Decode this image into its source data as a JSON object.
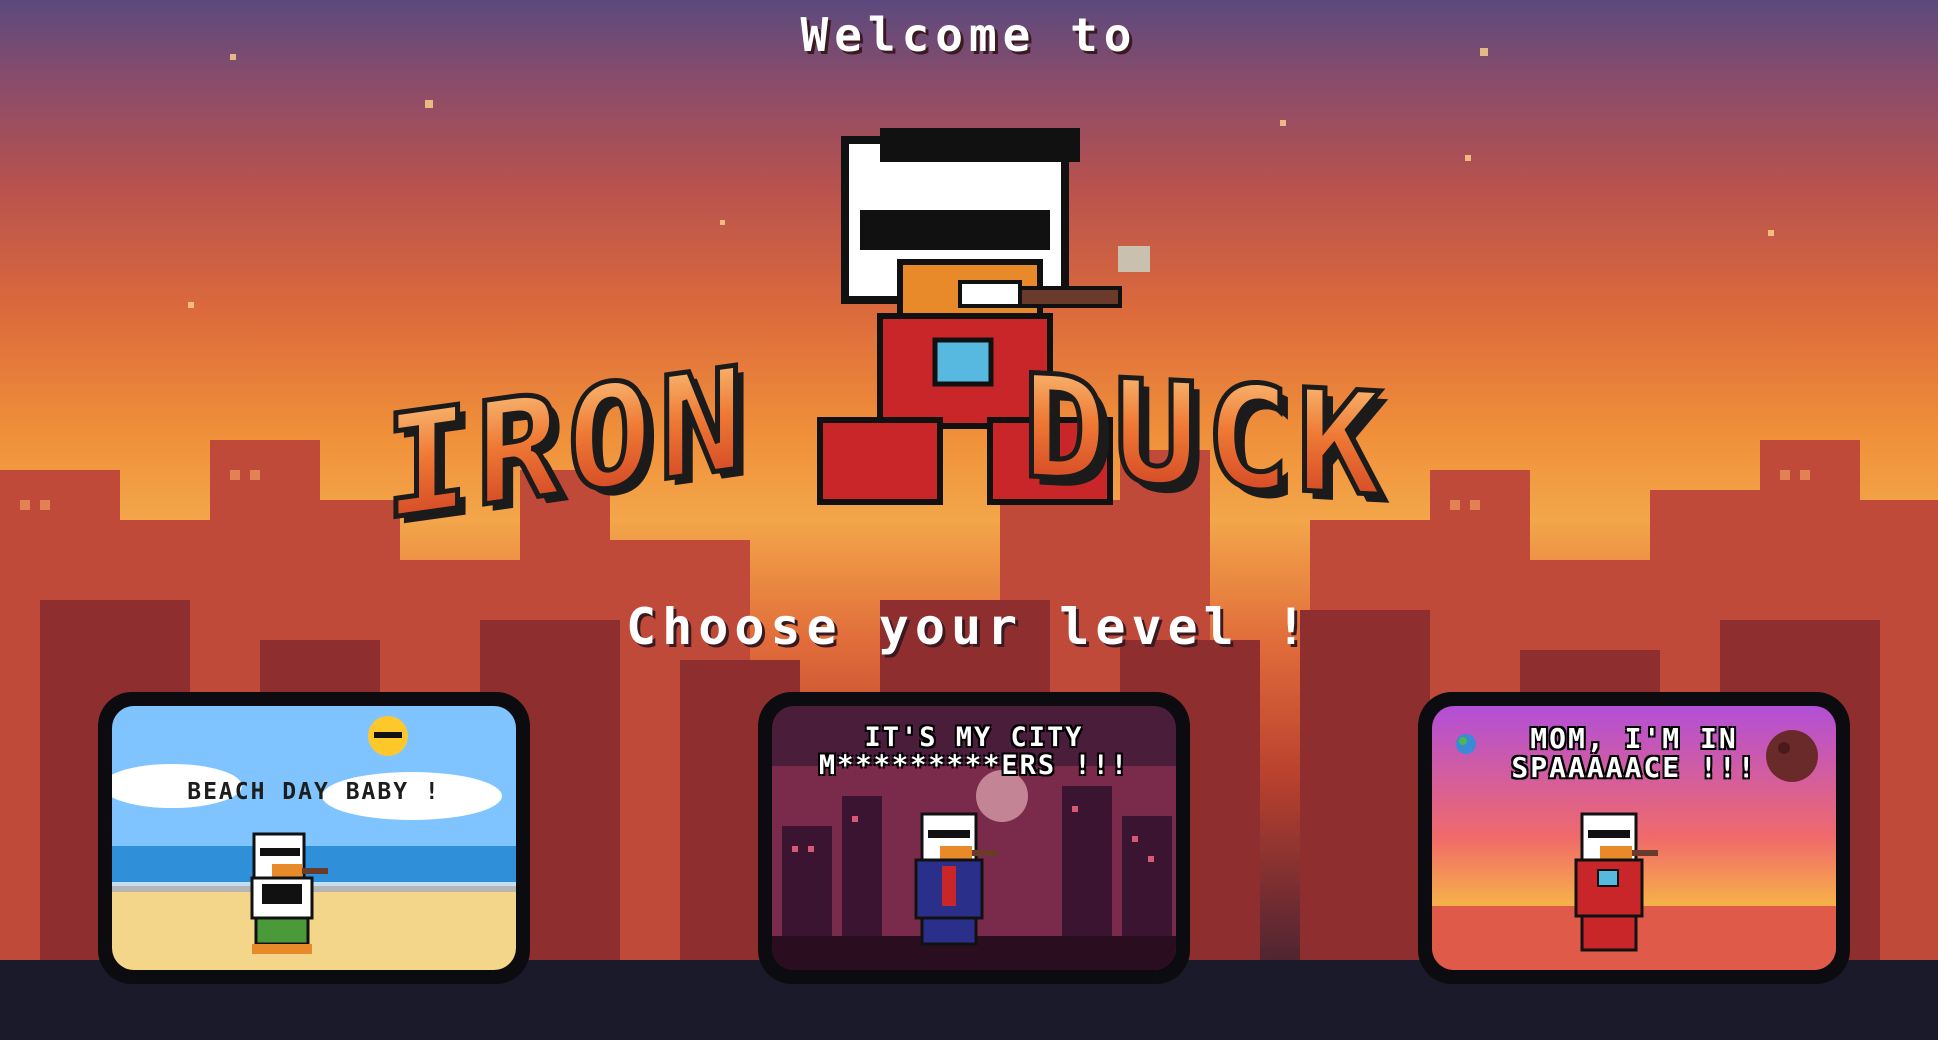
{
  "title": {
    "welcome": "Welcome to",
    "logo_left": "IRON",
    "logo_right": "DUCK"
  },
  "prompt": "Choose your level !",
  "levels": [
    {
      "id": "beach",
      "caption": "BEACH DAY BABY !",
      "sky": "#7fc4ff",
      "sea": "#2f8fd8",
      "ground": "#f3d68a"
    },
    {
      "id": "city",
      "caption_line1": "IT'S MY CITY",
      "caption_line2": "M*********ERS !!!",
      "sky": "#4a1d3a",
      "accent": "#ff6b8a"
    },
    {
      "id": "space",
      "caption_line1": "MOM, I'M IN",
      "caption_line2": "SPAAAAACE !!!",
      "sky": "#b24fd8",
      "ground": "#e05a4a"
    }
  ],
  "colors": {
    "logo_fill": "#ef6a35",
    "logo_outline": "#1b1b1b",
    "card_frame": "#0b0b10",
    "text": "#ffffff"
  },
  "icons": [
    "duck-mascot-icon",
    "sun-icon",
    "planet-icon",
    "moon-icon"
  ]
}
